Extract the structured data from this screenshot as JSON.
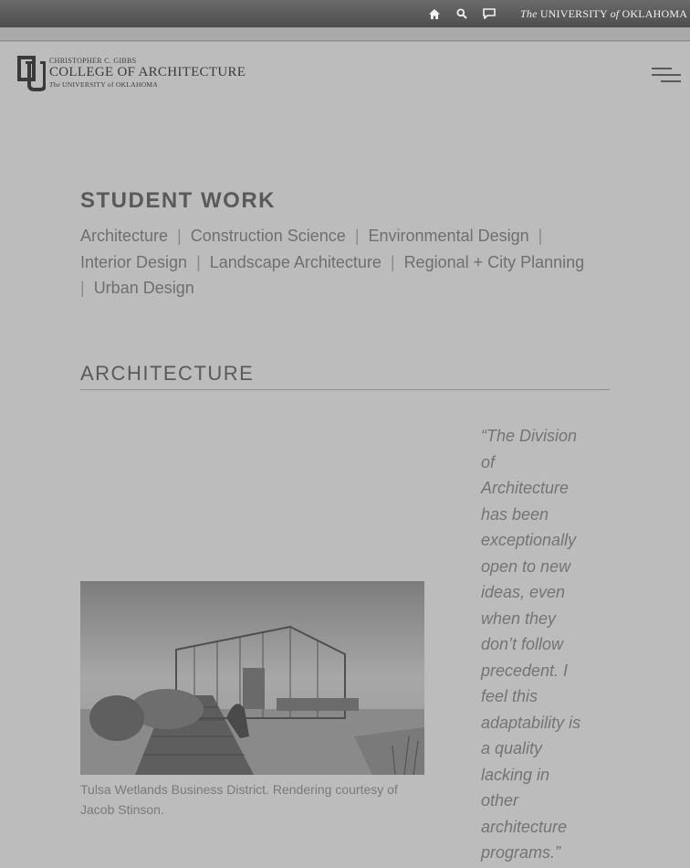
{
  "topbar": {
    "icons": [
      "home-icon",
      "search-icon",
      "chat-icon"
    ],
    "university_the": "The",
    "university_main": "UNIVERSITY",
    "university_of": "of",
    "university_state": "OKLAHOMA"
  },
  "logo": {
    "line1": "CHRISTOPHER C. GIBBS",
    "line2": "COLLEGE OF ARCHITECTURE",
    "line3_the": "The",
    "line3_main": "UNIVERSITY of OKLAHOMA"
  },
  "page_title": "STUDENT WORK",
  "categories": [
    "Architecture",
    "Construction Science",
    "Environmental Design",
    "Interior Design",
    "Landscape Architecture",
    "Regional + City Planning",
    "Urban Design"
  ],
  "separator": "|",
  "section_title": "ARCHITECTURE",
  "image_caption": "Tulsa Wetlands Business District. Rendering courtesy of Jacob Stinson.",
  "quote": "“The Division of Architecture has been exceptionally open to new ideas, even when they don’t follow precedent. I feel this adaptability is a quality lacking in other architecture programs.”"
}
